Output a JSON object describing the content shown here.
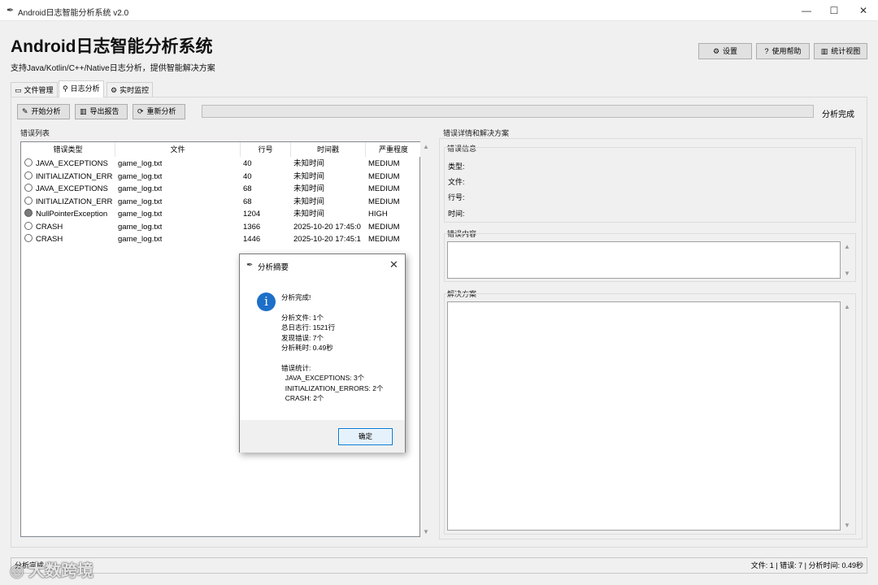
{
  "window": {
    "title": "Android日志智能分析系统 v2.0",
    "app_icon": "feather-icon",
    "controls": {
      "minimize": "—",
      "maximize": "☐",
      "close": "✕"
    }
  },
  "header": {
    "title": "Android日志智能分析系统",
    "subtitle": "支持Java/Kotlin/C++/Native日志分析，提供智能解决方案",
    "buttons": [
      {
        "icon": "gear-icon",
        "glyph": "⚙",
        "label": "设置"
      },
      {
        "icon": "help-icon",
        "glyph": "?",
        "label": "使用帮助"
      },
      {
        "icon": "chart-icon",
        "glyph": "▥",
        "label": "统计视图"
      }
    ]
  },
  "tabs": [
    {
      "icon": "folder-icon",
      "glyph": "🗀",
      "label": "文件管理"
    },
    {
      "icon": "magnifier-icon",
      "glyph": "🔍",
      "label": "日志分析",
      "active": true
    },
    {
      "icon": "monitor-icon",
      "glyph": "⚙",
      "label": "实时监控"
    }
  ],
  "toolbar": {
    "start_label": "开始分析",
    "start_glyph": "✎",
    "export_label": "导出报告",
    "export_glyph": "▥",
    "reanalyze_label": "重新分析",
    "reanalyze_glyph": "⟳",
    "progress_percent": 0,
    "progress_status": "分析完成"
  },
  "error_list": {
    "title": "错误列表",
    "columns": [
      "错误类型",
      "文件",
      "行号",
      "时间戳",
      "严重程度"
    ],
    "rows": [
      {
        "type": "JAVA_EXCEPTIONS",
        "file": "game_log.txt",
        "line": "40",
        "time": "未知时间",
        "severity": "MEDIUM",
        "selected": false
      },
      {
        "type": "INITIALIZATION_ERR",
        "file": "game_log.txt",
        "line": "40",
        "time": "未知时间",
        "severity": "MEDIUM",
        "selected": false
      },
      {
        "type": "JAVA_EXCEPTIONS",
        "file": "game_log.txt",
        "line": "68",
        "time": "未知时间",
        "severity": "MEDIUM",
        "selected": false
      },
      {
        "type": "INITIALIZATION_ERR",
        "file": "game_log.txt",
        "line": "68",
        "time": "未知时间",
        "severity": "MEDIUM",
        "selected": false
      },
      {
        "type": "NullPointerException",
        "file": "game_log.txt",
        "line": "1204",
        "time": "未知时间",
        "severity": "HIGH",
        "selected": true
      },
      {
        "type": "CRASH",
        "file": "game_log.txt",
        "line": "1366",
        "time": "2025-10-20 17:45:0",
        "severity": "MEDIUM",
        "selected": false
      },
      {
        "type": "CRASH",
        "file": "game_log.txt",
        "line": "1446",
        "time": "2025-10-20 17:45:1",
        "severity": "MEDIUM",
        "selected": false
      }
    ]
  },
  "details": {
    "title": "错误详情和解决方案",
    "info_title": "错误信息",
    "type_label": "类型:",
    "file_label": "文件:",
    "line_label": "行号:",
    "time_label": "时间:",
    "content_title": "错误内容",
    "solution_title": "解决方案"
  },
  "dialog": {
    "title": "分析摘要",
    "close_glyph": "✕",
    "info_glyph": "i",
    "message": "分析完成!\n\n分析文件: 1个\n总日志行: 1521行\n发现错误: 7个\n分析耗时: 0.49秒\n\n错误统计:\n  JAVA_EXCEPTIONS: 3个\n  INITIALIZATION_ERRORS: 2个\n  CRASH: 2个",
    "ok_label": "确定"
  },
  "statusbar": {
    "left": "分析完成",
    "right": "文件: 1 | 错误: 7 | 分析时间: 0.49秒"
  },
  "watermark": "大数跨境",
  "colors": {
    "progress": "#06b025",
    "info_icon": "#1d6fc8",
    "ok_border": "#0078d7"
  }
}
